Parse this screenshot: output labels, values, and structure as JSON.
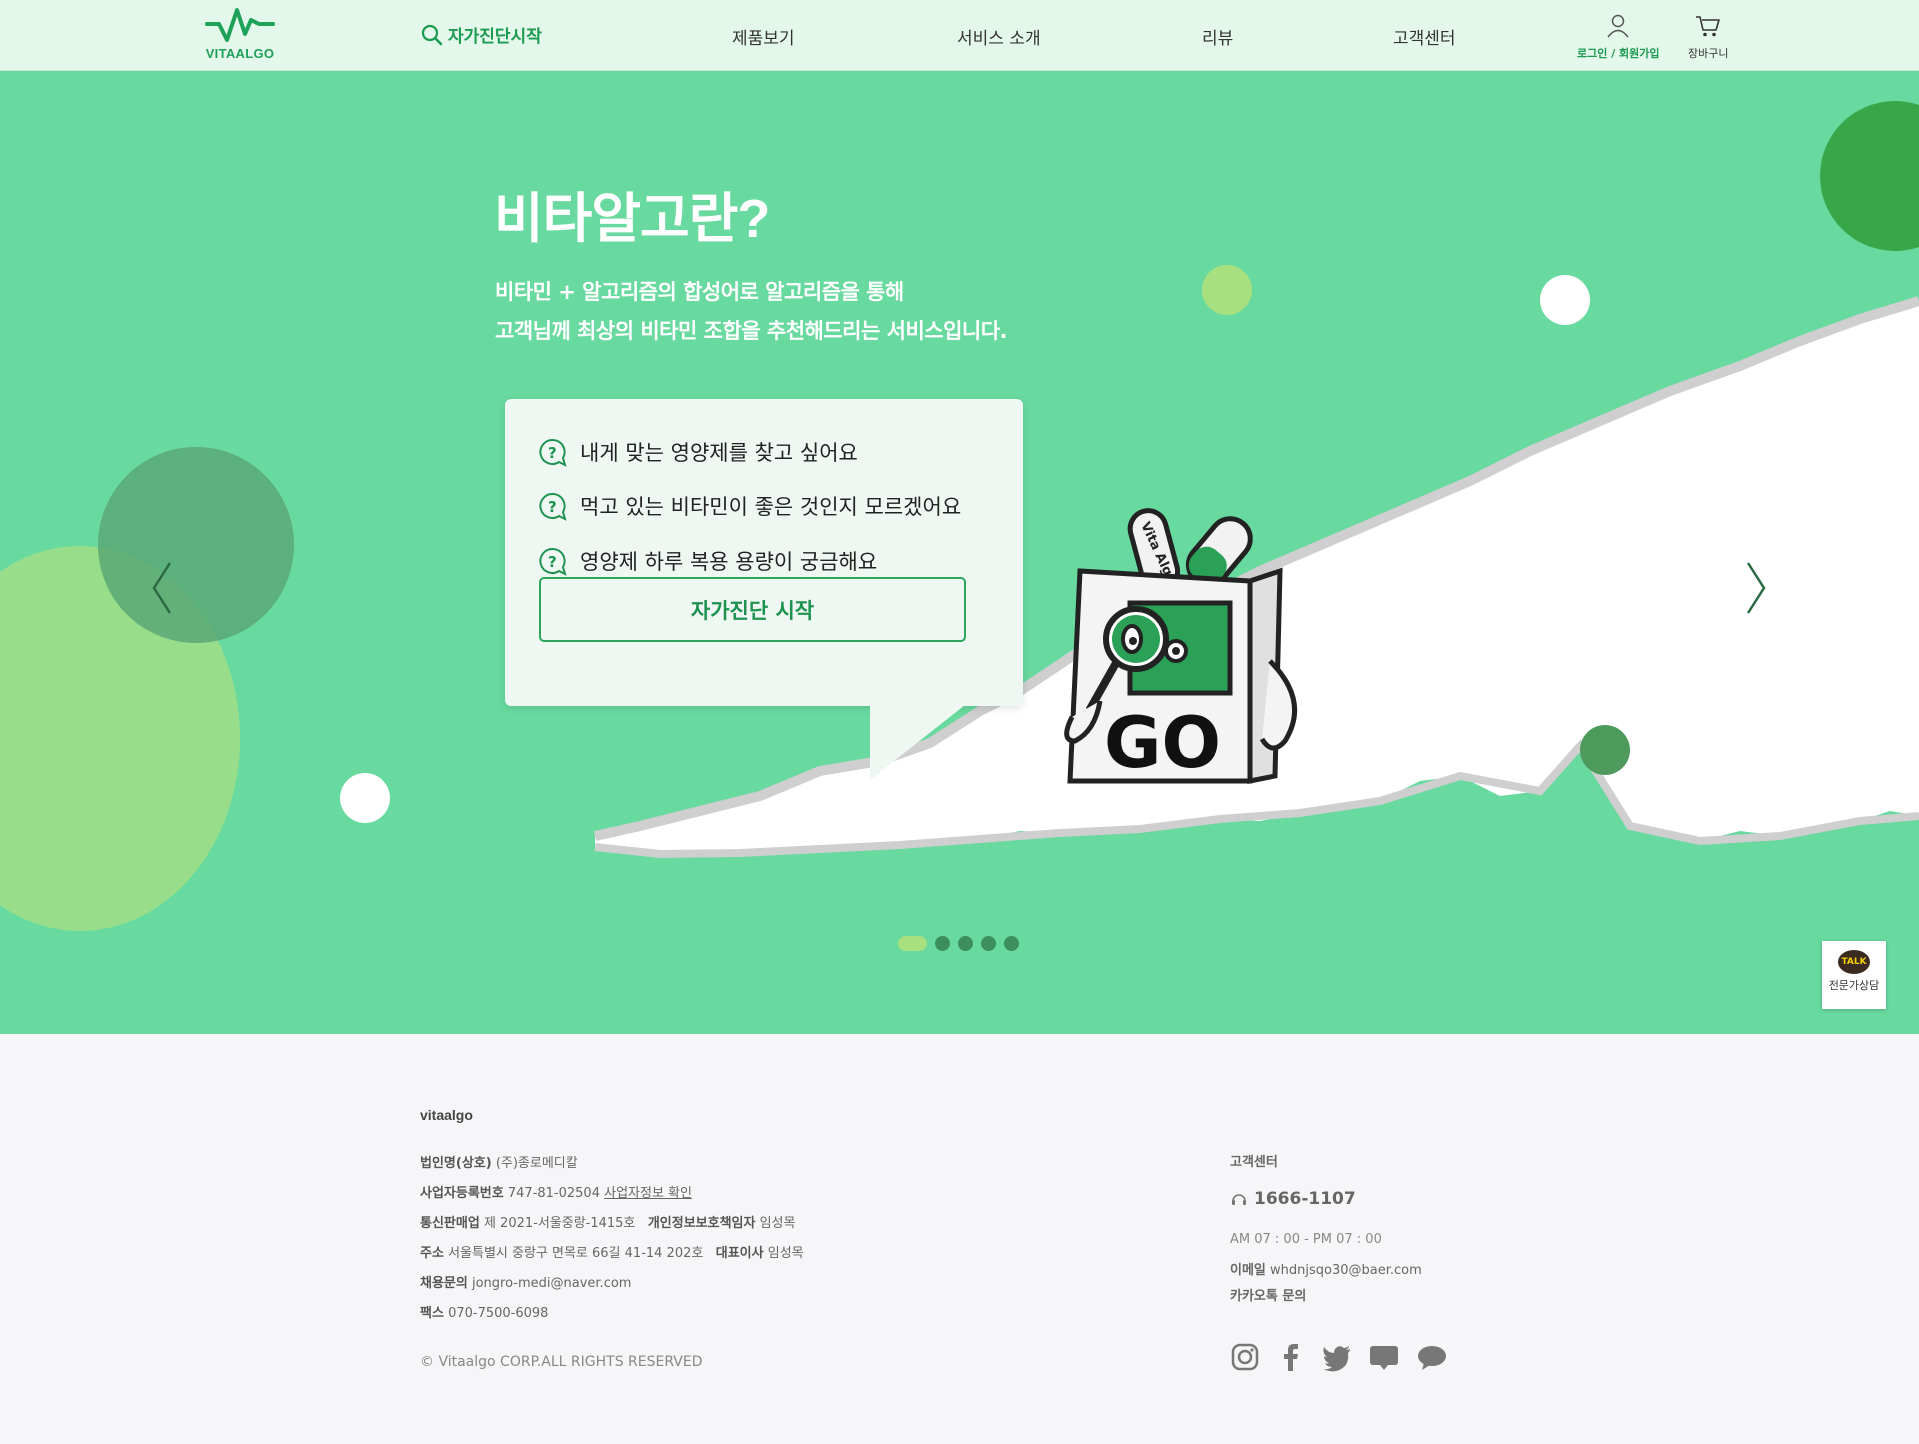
{
  "header": {
    "logo_text": "VITAALGO",
    "start_label": "자가진단시작",
    "nav": [
      {
        "label": "제품보기"
      },
      {
        "label": "서비스 소개"
      },
      {
        "label": "리뷰"
      },
      {
        "label": "고객센터"
      }
    ],
    "login_label": "로그인 / 회원가입",
    "cart_label": "장바구니"
  },
  "hero": {
    "title": "비타알고란?",
    "subtitle_line1": "비타민 + 알고리즘의 합성어로 알고리즘을 통해",
    "subtitle_line2": "고객님께 최상의 비타민 조합을 추천해드리는 서비스입니다.",
    "questions": [
      "내게 맞는 영양제를 찾고 싶어요",
      "먹고 있는 비타민이 좋은 것인지 모르겠어요",
      "영양제 하루 복용 용량이 궁금해요"
    ],
    "cta_label": "자가진단 시작",
    "character_text": "GO",
    "bottle_text": "Vita Algo",
    "slides_count": 5,
    "active_slide": 1
  },
  "talk": {
    "badge": "TALK",
    "label": "전문가상담"
  },
  "footer": {
    "brand": "vitaalgo",
    "company_label": "법인명(상호)",
    "company": "(주)종로메디칼",
    "bizno_label": "사업자등록번호",
    "bizno": "747-81-02504",
    "bizno_link": "사업자정보 확인",
    "telecom_label": "통신판매업",
    "telecom": "제 2021-서울중랑-1415호",
    "privacy_label": "개인정보보호책임자",
    "privacy": "임성목",
    "address_label": "주소",
    "address": "서울특별시 중랑구 면목로 66길 41-14 202호",
    "ceo_label": "대표이사",
    "ceo": "임성목",
    "recruit_label": "채용문의",
    "recruit": "jongro-medi@naver.com",
    "fax_label": "팩스",
    "fax": "070-7500-6098",
    "copyright": "© Vitaalgo CORP.ALL RIGHTS RESERVED",
    "cs_title": "고객센터",
    "cs_phone": "1666-1107",
    "cs_hours": "AM 07 : 00 - PM 07 : 00",
    "email_label": "이메일",
    "email": "whdnjsqo30@baer.com",
    "kakao_label": "카카오톡 문의"
  },
  "colors": {
    "hero_bg": "#68d99f",
    "brand_green": "#1ea25a",
    "header_bg": "#e4f7eb",
    "footer_bg": "#f6f6f8"
  }
}
